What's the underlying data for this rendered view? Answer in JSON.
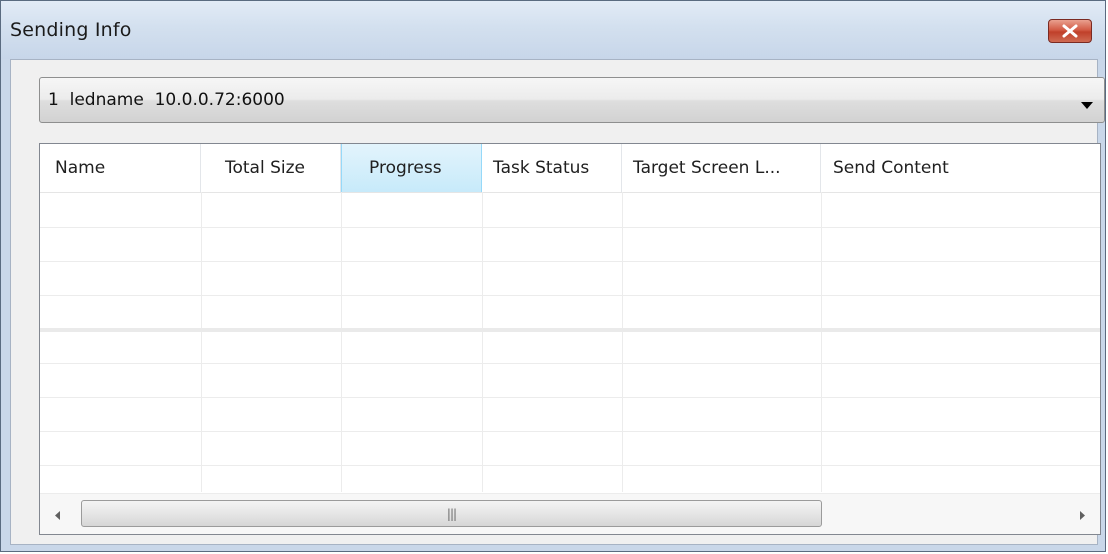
{
  "window": {
    "title": "Sending Info",
    "close_icon": "close-icon"
  },
  "device_select": {
    "value": "1  ledname  10.0.0.72:6000",
    "icon": "chevron-down-icon"
  },
  "table": {
    "columns": [
      "Name",
      "Total Size",
      "Progress",
      "Task Status",
      "Target Screen L...",
      "Send Content"
    ],
    "sorted_column": "Progress",
    "rows": []
  },
  "scrollbar": {
    "left_icon": "arrow-left-icon",
    "right_icon": "arrow-right-icon",
    "grip_icon": "grip-icon"
  },
  "colors": {
    "title_bar": "#d3e0ef",
    "close_button": "#c7432d",
    "active_header": "#c7eafa"
  }
}
